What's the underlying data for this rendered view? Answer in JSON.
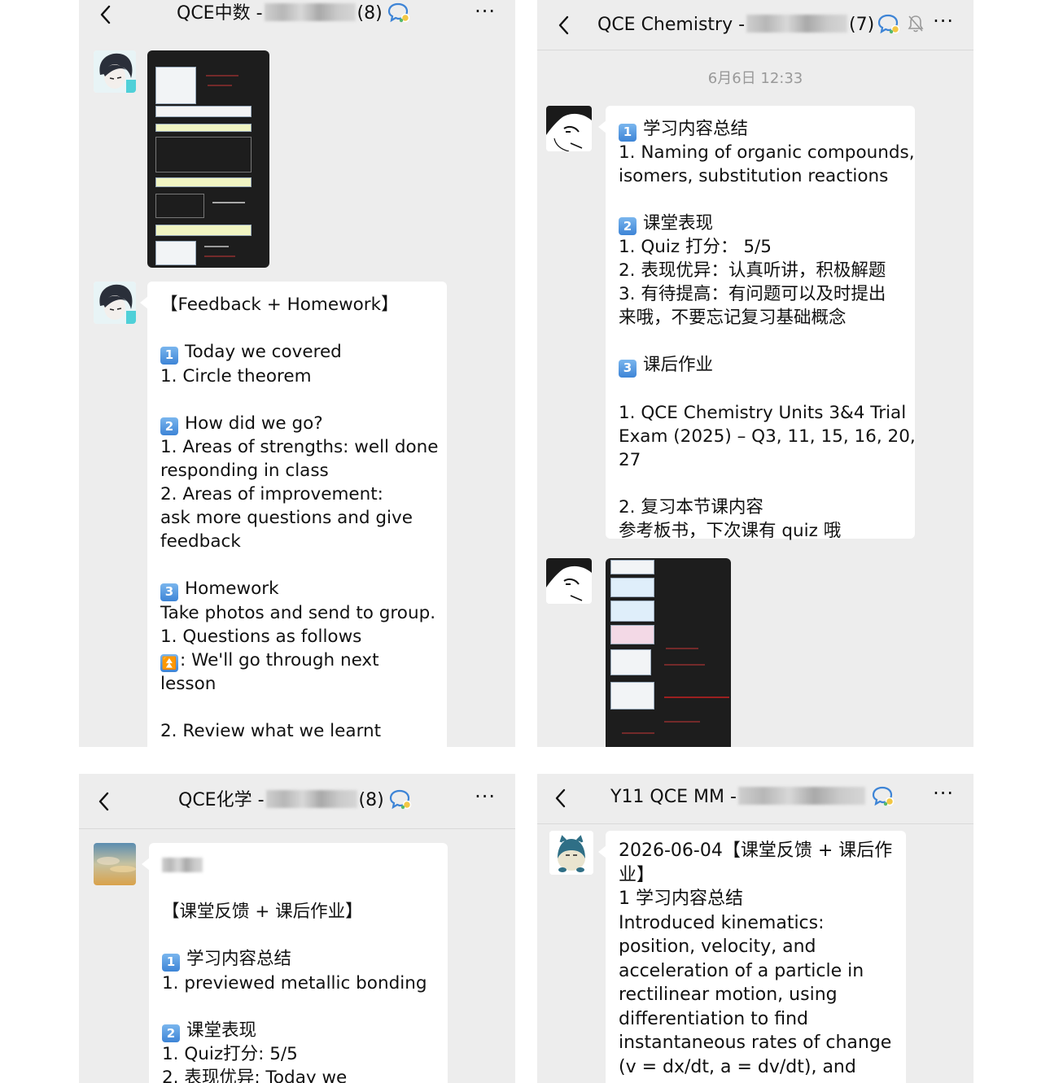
{
  "panel1": {
    "title_prefix": "QCE中数 -",
    "title_count": "(8)",
    "more": "···",
    "icons": [
      "back-icon",
      "group-chat-icon",
      "more-icon"
    ],
    "message_lines": [
      "【Feedback + Homework】",
      "",
      "Today we covered",
      "1.  Circle theorem",
      "",
      "How did we go?",
      "1.  Areas of strengths: well done",
      "responding in class",
      "2.  Areas of improvement:",
      "ask more questions and give",
      "feedback",
      "",
      "Homework",
      "Take photos and send to group.",
      "1.   Questions as follows",
      ":   We'll go through next",
      "lesson",
      "",
      "2.  Review what we learnt"
    ],
    "badges": {
      "b1": "1",
      "b2": "2",
      "b3": "3"
    }
  },
  "panel2": {
    "title_prefix": "QCE Chemistry -",
    "title_count": "(7)",
    "more": "···",
    "timestamp": "6月6日 12:33",
    "message_lines": [
      "学习内容总结",
      "1.  Naming of organic compounds,",
      "isomers, substitution reactions",
      "",
      "课堂表现",
      "1.  Quiz 打分：  5/5",
      "2.  表现优异：认真听讲，积极解题",
      "3.  有待提高：有问题可以及时提出",
      "来哦，不要忘记复习基础概念",
      "",
      "课后作业",
      "",
      "1.  QCE Chemistry Units 3&4 Trial",
      "Exam (2025) – Q3, 11, 15, 16, 20,",
      "27",
      "",
      "2.  复习本节课内容",
      "参考板书，下次课有 quiz 哦"
    ],
    "badges": {
      "b1": "1",
      "b2": "2",
      "b3": "3"
    }
  },
  "panel3": {
    "title_prefix": "QCE化学 -",
    "title_count": "(8)",
    "more": "···",
    "message_lines": [
      "",
      "",
      "【课堂反馈 + 课后作业】",
      "",
      "学习内容总结",
      "1. previewed metallic bonding",
      "",
      "课堂表现",
      "1.  Quiz打分: 5/5",
      "2.  表现优异:  Today we"
    ],
    "badges": {
      "b1": "1",
      "b2": "2"
    }
  },
  "panel4": {
    "title_prefix": "Y11 QCE MM -",
    "more": "···",
    "message_lines": [
      "2026-06-04【课堂反馈 + 课后作",
      "业】",
      "1 学习内容总结",
      "Introduced kinematics:",
      "position, velocity, and",
      "acceleration of a particle in",
      "rectilinear motion, using",
      "differentiation to find",
      "instantaneous rates of change",
      "(v = dx/dt, a = dv/dt), and"
    ]
  },
  "colors": {
    "panel_bg": "#ededed",
    "bubble_bg": "#ffffff",
    "badge_blue": "#3d84d6",
    "timestamp": "#999999"
  }
}
